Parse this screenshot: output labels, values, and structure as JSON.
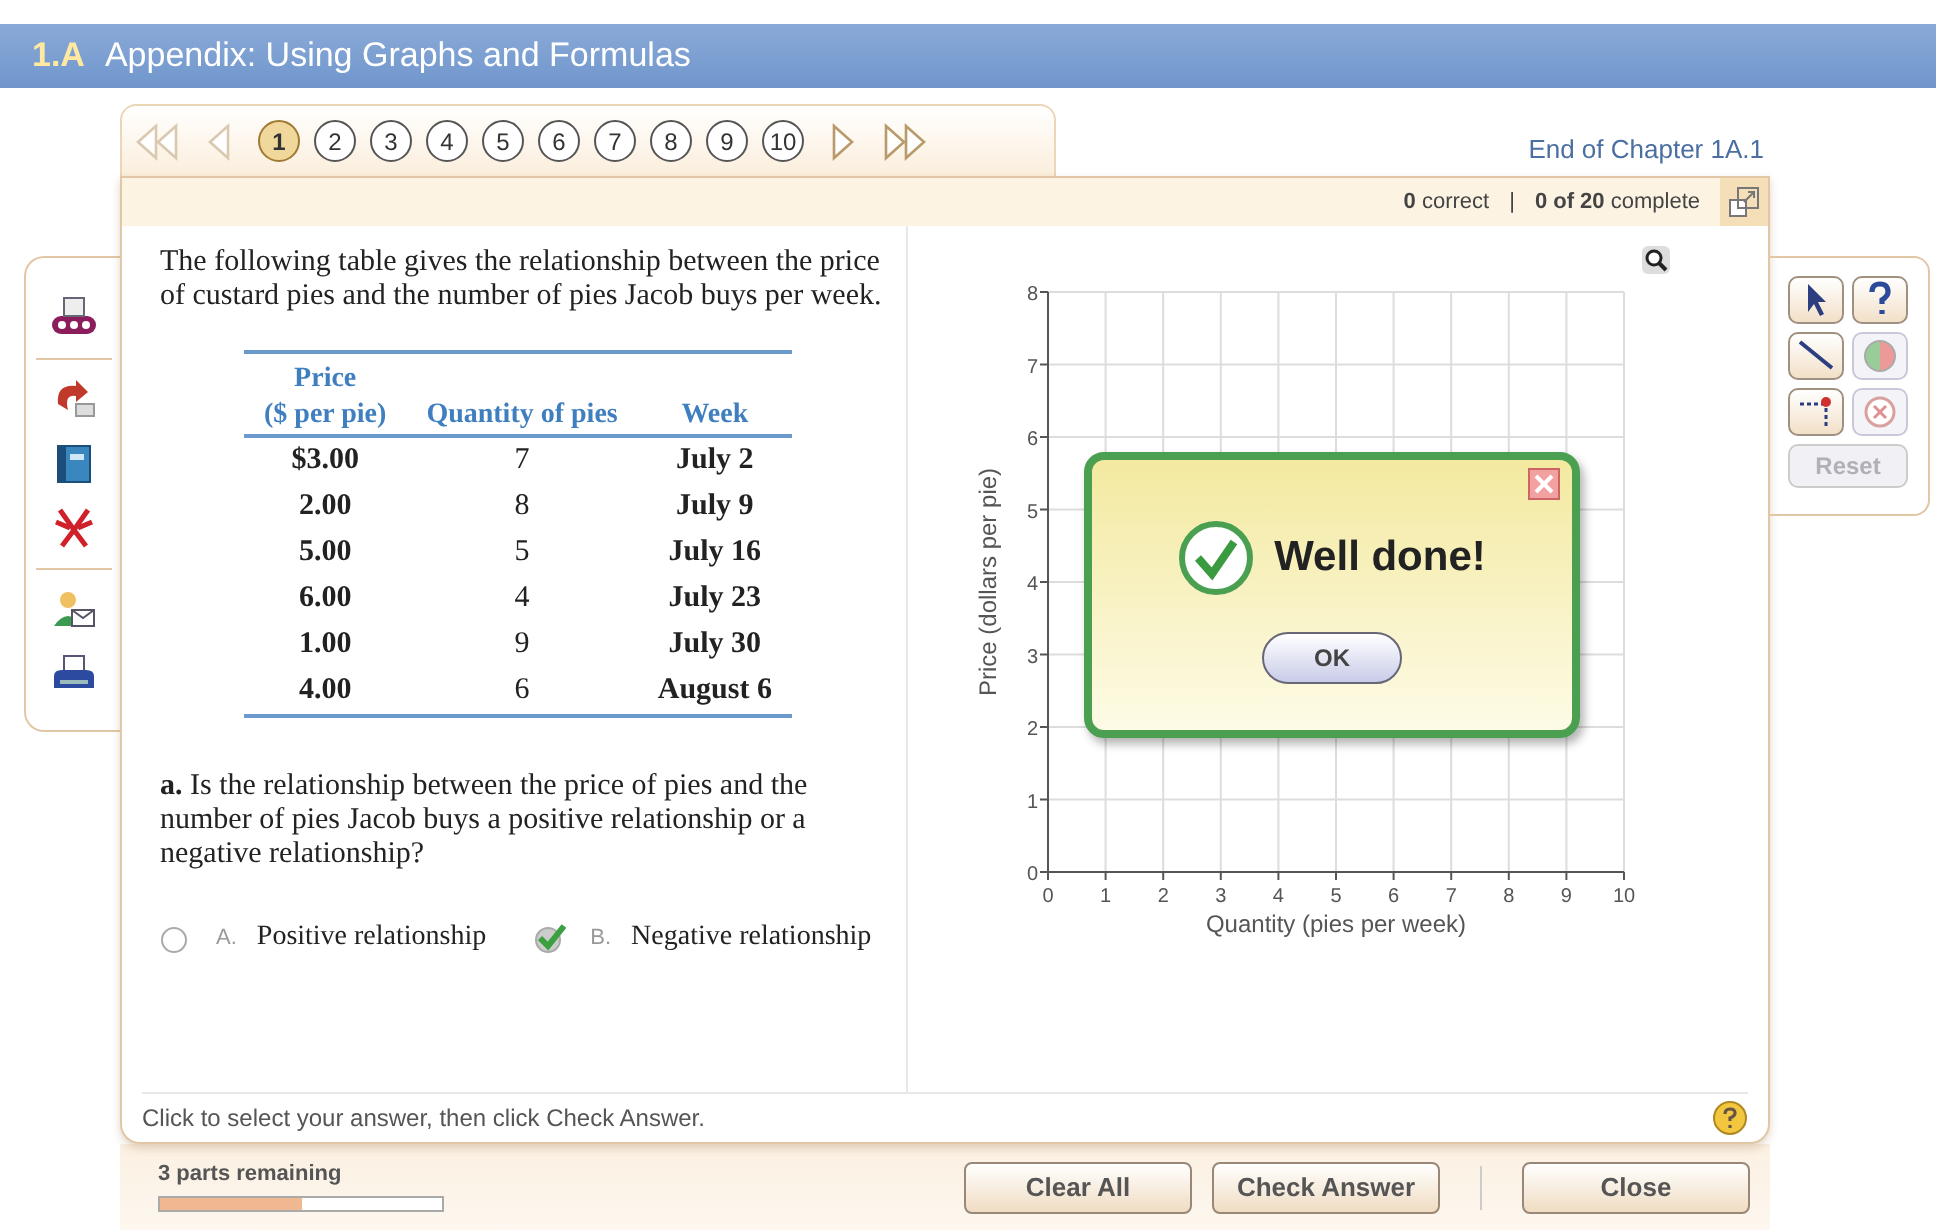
{
  "header": {
    "section": "1.A",
    "title": "Appendix: Using Graphs and Formulas"
  },
  "nav": {
    "back_buttons": [
      {
        "kind": "first",
        "disabled": true
      },
      {
        "kind": "previous",
        "disabled": true
      }
    ],
    "pages": [
      {
        "label": "1",
        "selected": true
      },
      {
        "label": "2",
        "selected": false
      },
      {
        "label": "3",
        "selected": false
      },
      {
        "label": "4",
        "selected": false
      },
      {
        "label": "5",
        "selected": false
      },
      {
        "label": "6",
        "selected": false
      },
      {
        "label": "7",
        "selected": false
      },
      {
        "label": "8",
        "selected": false
      },
      {
        "label": "9",
        "selected": false
      },
      {
        "label": "10",
        "selected": false
      }
    ],
    "forward_buttons": [
      {
        "kind": "next",
        "disabled": false
      },
      {
        "kind": "last",
        "disabled": false
      }
    ],
    "end_link": "End of Chapter 1A.1"
  },
  "status": {
    "correct_count": "0",
    "correct_label": "correct",
    "separator": "|",
    "complete_count": "0 of 20",
    "complete_label": "complete"
  },
  "left_tools": [
    {
      "kind": "numbers"
    },
    {
      "kind": "share"
    },
    {
      "kind": "book"
    },
    {
      "kind": "figure"
    },
    {
      "kind": "contact"
    },
    {
      "kind": "print"
    }
  ],
  "right_tools": [
    {
      "kind": "pointer",
      "disabled": false
    },
    {
      "kind": "help",
      "disabled": false
    },
    {
      "kind": "line",
      "disabled": false
    },
    {
      "kind": "circle",
      "disabled": true
    },
    {
      "kind": "point",
      "disabled": false
    },
    {
      "kind": "delete",
      "disabled": true
    }
  ],
  "reset": {
    "label": "Reset",
    "disabled": true
  },
  "question": {
    "intro": "The following table gives the relationship between the price of custard pies and the number of pies Jacob buys per week.",
    "table": {
      "columns": [
        "Price\n($ per pie)",
        "Quantity of pies",
        "Week"
      ],
      "rows": [
        [
          "$3.00",
          "7",
          "July 2"
        ],
        [
          "2.00",
          "8",
          "July 9"
        ],
        [
          "5.00",
          "5",
          "July 16"
        ],
        [
          "6.00",
          "4",
          "July 23"
        ],
        [
          "1.00",
          "9",
          "July 30"
        ],
        [
          "4.00",
          "6",
          "August 6"
        ]
      ]
    },
    "part": "**a.** Is the relationship between the price of pies and the number of pies Jacob buys a positive relationship or a negative relationship?",
    "options": [
      {
        "letter": "A.",
        "text": "Positive relationship",
        "selected": false
      },
      {
        "letter": "B.",
        "text": "Negative relationship",
        "selected": true
      }
    ]
  },
  "graph": {
    "chart_data": {
      "type": "scatter",
      "grid": true,
      "xlabel": "Quantity (pies per week)",
      "ylabel": "Price (dollars per pie)",
      "xlim": [
        0,
        10
      ],
      "ylim": [
        0,
        8
      ],
      "xticks": [
        0,
        1,
        2,
        3,
        4,
        5,
        6,
        7,
        8,
        9,
        10
      ],
      "yticks": [
        0,
        1,
        2,
        3,
        4,
        5,
        6,
        7,
        8
      ]
    }
  },
  "dialog": {
    "message": "Well done!",
    "button": "OK"
  },
  "footer": {
    "instruction": "Click to select your answer, then click Check Answer."
  },
  "progress": {
    "label": "3 parts remaining",
    "level": 0.5
  },
  "buttons": [
    "Clear All",
    "Check Answer",
    "Close"
  ]
}
